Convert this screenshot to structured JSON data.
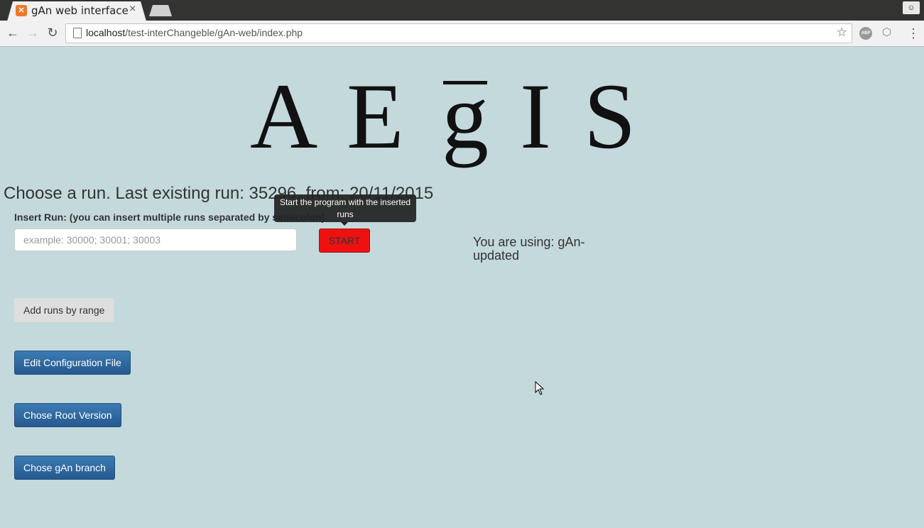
{
  "browser": {
    "tab_title": "gAn web interface",
    "tab_close": "×",
    "url_host": "localhost",
    "url_path": "/test-interChangeble/gAn-web/index.php",
    "abp_label": "ABP"
  },
  "logo": {
    "letters": [
      "A",
      "E",
      "g",
      "I",
      "S"
    ]
  },
  "page": {
    "heading": "Choose a run. Last existing run: 35296, from: 20/11/2015",
    "insert_label": "Insert Run: (you can insert multiple runs separated by semicolon)",
    "run_input_placeholder": "example: 30000; 30001; 30003",
    "start_label": "START",
    "tooltip": "Start the program with the inserted runs",
    "using_text": "You are using: gAn-updated",
    "add_range_label": "Add runs by range",
    "edit_config_label": "Edit Configuration File",
    "root_version_label": "Chose Root Version",
    "gan_branch_label": "Chose gAn branch"
  },
  "colors": {
    "page_background": "#c4d9dc",
    "start_button": "#ee1111",
    "primary_button": "#2e6da4"
  }
}
